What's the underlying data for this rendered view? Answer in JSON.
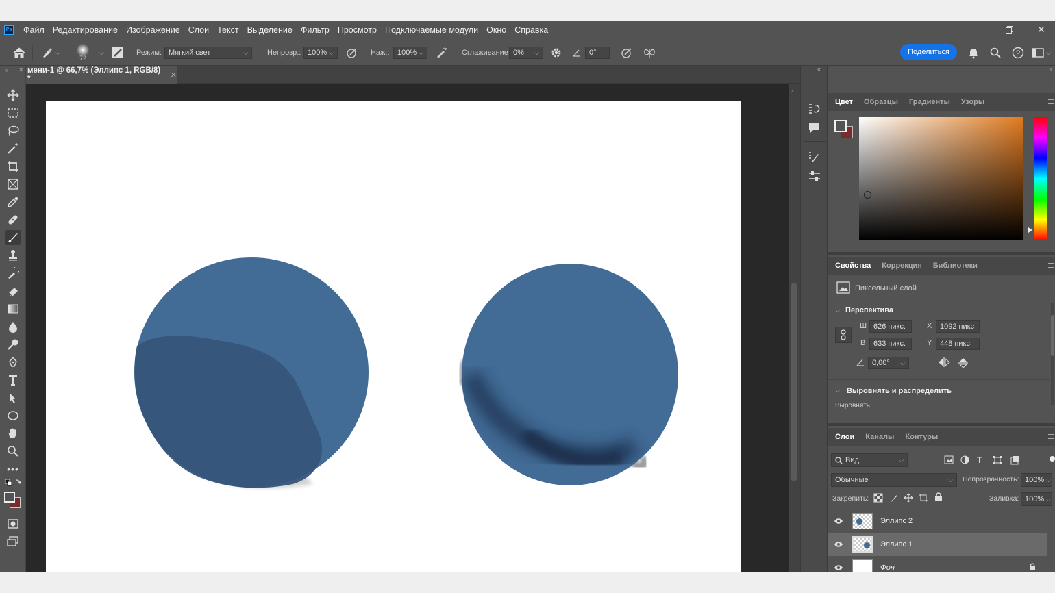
{
  "menubar": {
    "logo": "Ps",
    "items": [
      "Файл",
      "Редактирование",
      "Изображение",
      "Слои",
      "Текст",
      "Выделение",
      "Фильтр",
      "Просмотр",
      "Подключаемые модули",
      "Окно",
      "Справка"
    ]
  },
  "options": {
    "brush_size": "72",
    "mode_label": "Режим:",
    "mode_value": "Мягкий свет",
    "opacity_label": "Непрозр.:",
    "opacity_value": "100%",
    "flow_label": "Наж.:",
    "flow_value": "100%",
    "smoothing_label": "Сглаживание:",
    "smoothing_value": "0%",
    "angle_value": "0°",
    "share_label": "Поделиться"
  },
  "document": {
    "tab_title": "мени-1 @ 66,7% (Эллипс 1, RGB/8) *"
  },
  "color_panel": {
    "tabs": [
      "Цвет",
      "Образцы",
      "Градиенты",
      "Узоры"
    ],
    "hue_color": "#e07a1f",
    "foreground": "#f0f0f0",
    "background": "#7a2b2b"
  },
  "properties_panel": {
    "tabs": [
      "Свойства",
      "Коррекция",
      "Библиотеки"
    ],
    "layer_kind": "Пиксельный слой",
    "transform_title": "Перспектива",
    "w_label": "Ш",
    "w_value": "626 пикс.",
    "h_label": "В",
    "h_value": "633 пикс.",
    "x_label": "X",
    "x_value": "1092 пикс",
    "y_label": "Y",
    "y_value": "448 пикс.",
    "angle_value": "0,00°",
    "align_title": "Выровнять и распределить",
    "align_label": "Выровнять:"
  },
  "layers_panel": {
    "tabs": [
      "Слои",
      "Каналы",
      "Контуры"
    ],
    "filter_value": "Вид",
    "blend_value": "Обычные",
    "opacity_label": "Непрозрачность:",
    "opacity_value": "100%",
    "lock_label": "Закрепить:",
    "fill_label": "Заливка:",
    "fill_value": "100%",
    "layers": [
      {
        "name": "Эллипс 2"
      },
      {
        "name": "Эллипс 1"
      },
      {
        "name": "Фон"
      }
    ]
  },
  "colors": {
    "ellipse": "#426b95",
    "ellipse_shadow": "#36557a",
    "panel_bg": "#535353",
    "canvas_bg": "#282828",
    "accent": "#1473e6"
  }
}
